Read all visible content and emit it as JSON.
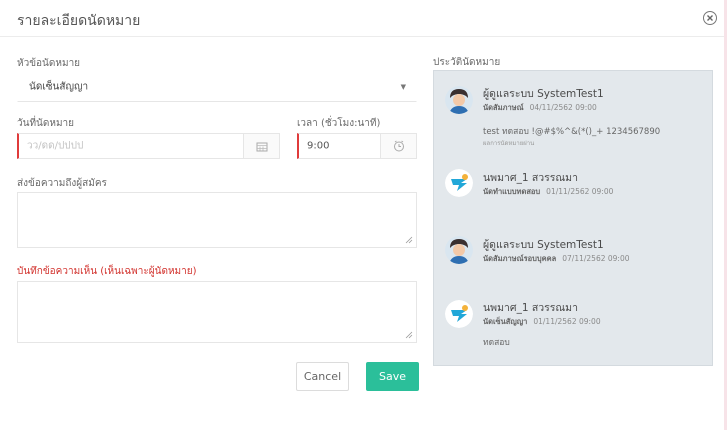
{
  "modal": {
    "title": "รายละเอียดนัดหมาย"
  },
  "form": {
    "topic_label": "หัวข้อนัดหมาย",
    "topic_value": "นัดเซ็นสัญญา",
    "date_label": "วันที่นัดหมาย",
    "date_placeholder": "วว/ดด/ปปปป",
    "time_label": "เวลา (ชั่วโมง:นาที)",
    "time_value": "9:00",
    "message_label": "ส่งข้อความถึงผู้สมัคร",
    "message_value": "",
    "note_label": "บันทึกข้อความเห็น (เห็นเฉพาะผู้นัดหมาย)",
    "note_value": ""
  },
  "buttons": {
    "cancel": "Cancel",
    "save": "Save"
  },
  "history": {
    "title": "ประวัตินัดหมาย",
    "entries": [
      {
        "name": "ผู้ดูแลระบบ SystemTest1",
        "type": "นัดสัมภาษณ์",
        "datetime": "04/11/2562 09:00",
        "text": "test ทดสอบ !@#$%^&(*()_+ 1234567890",
        "sub": "ผลการนัดหมายผ่าน",
        "avatar": "person-avatar"
      },
      {
        "name": "นพมาศ_1 สวรรณมา",
        "type": "นัดทำแบบทดสอบ",
        "datetime": "01/11/2562 09:00",
        "text": "",
        "sub": "",
        "avatar": "company-logo"
      },
      {
        "name": "ผู้ดูแลระบบ SystemTest1",
        "type": "นัดสัมภาษณ์รอบบุคคล",
        "datetime": "07/11/2562 09:00",
        "text": "",
        "sub": "",
        "avatar": "person-avatar"
      },
      {
        "name": "นพมาศ_1 สวรรณมา",
        "type": "นัดเซ็นสัญญา",
        "datetime": "01/11/2562 09:00",
        "text": "ทดสอบ",
        "sub": "",
        "avatar": "company-logo"
      }
    ]
  },
  "colors": {
    "save": "#2bbf9a",
    "required": "#e03b3b",
    "history_bg": "#e3e8ec"
  }
}
